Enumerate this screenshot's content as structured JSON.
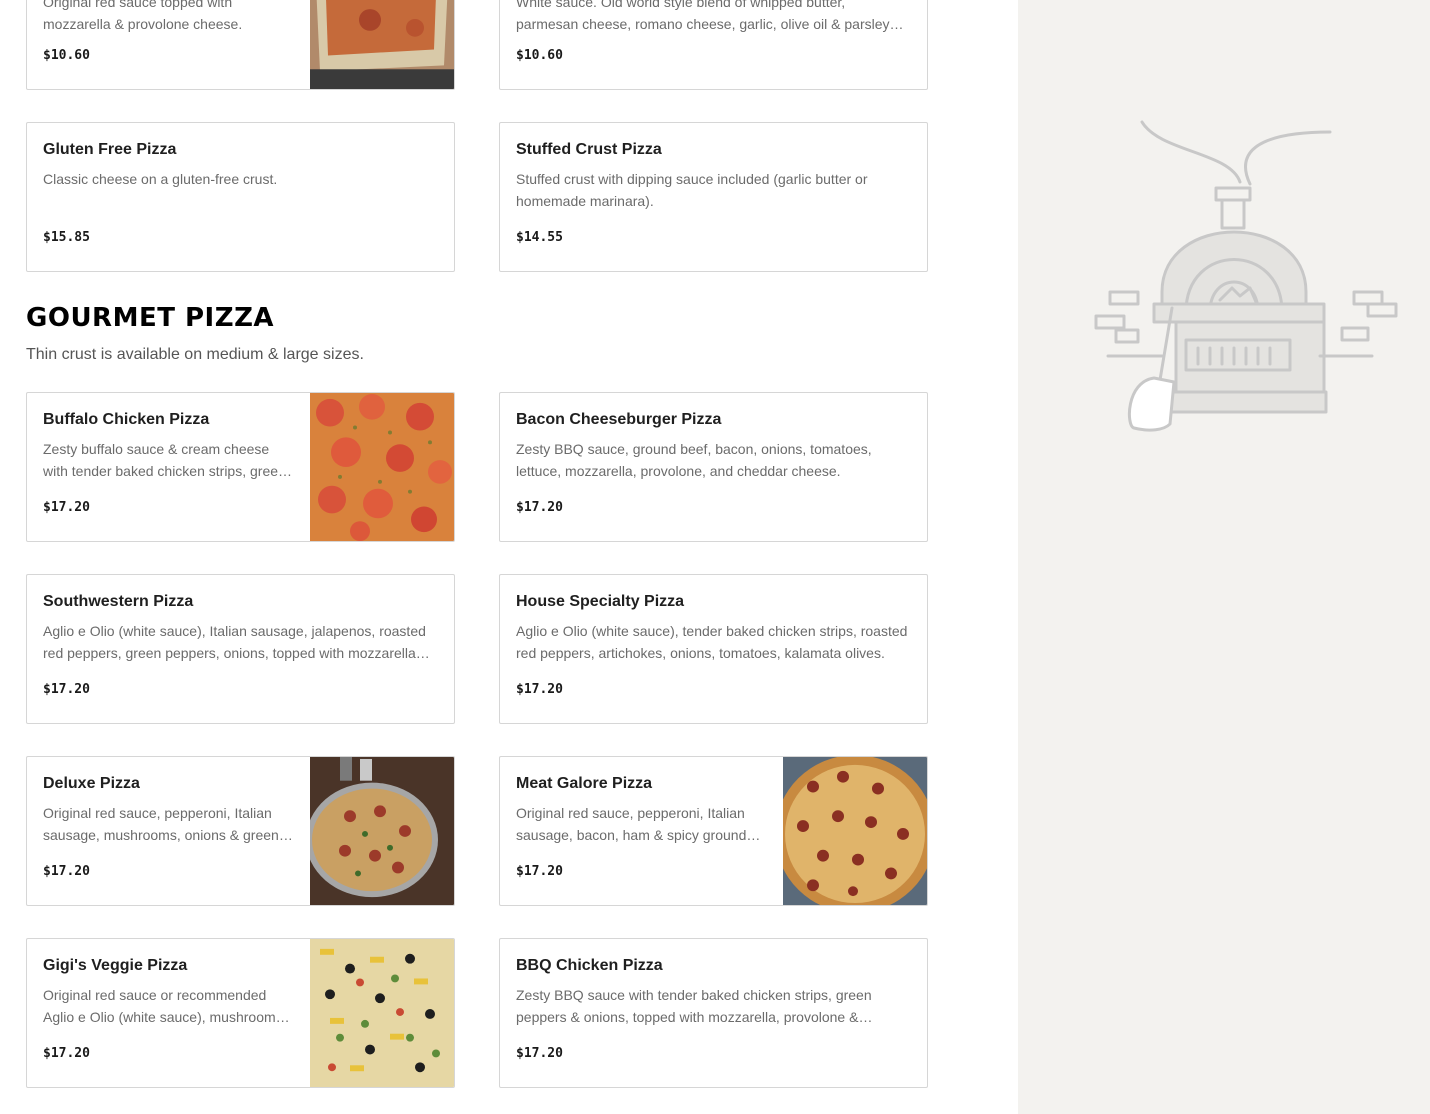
{
  "top_items": [
    {
      "name": "",
      "desc": "Original red sauce topped with mozzarella & provolone cheese.",
      "price": "$10.60"
    },
    {
      "name": "",
      "desc": "White sauce. Old world style blend of whipped butter, parmesan cheese, romano cheese, garlic, olive oil & parsley flakes.",
      "price": "$10.60"
    }
  ],
  "items_a": [
    {
      "name": "Gluten Free Pizza",
      "desc": "Classic cheese on a gluten-free crust.",
      "price": "$15.85"
    },
    {
      "name": "Stuffed Crust Pizza",
      "desc": "Stuffed crust with dipping sauce included (garlic butter or homemade marinara).",
      "price": "$14.55"
    }
  ],
  "gourmet": {
    "title": "GOURMET PIZZA",
    "note": "Thin crust is available on medium & large sizes.",
    "items": [
      {
        "name": "Buffalo Chicken Pizza",
        "desc": "Zesty buffalo sauce & cream cheese with tender baked chicken strips, green peppers & onions.",
        "price": "$17.20"
      },
      {
        "name": "Bacon Cheeseburger Pizza",
        "desc": "Zesty BBQ sauce, ground beef, bacon, onions, tomatoes, lettuce, mozzarella, provolone, and cheddar cheese.",
        "price": "$17.20"
      },
      {
        "name": "Southwestern Pizza",
        "desc": "Aglio e Olio (white sauce), Italian sausage, jalapenos, roasted red peppers, green peppers, onions, topped with mozzarella cheese.",
        "price": "$17.20"
      },
      {
        "name": "House Specialty Pizza",
        "desc": "Aglio e Olio (white sauce), tender baked chicken strips, roasted red peppers, artichokes, onions, tomatoes, kalamata olives.",
        "price": "$17.20"
      },
      {
        "name": "Deluxe Pizza",
        "desc": "Original red sauce, pepperoni, Italian sausage, mushrooms, onions & green peppers.",
        "price": "$17.20"
      },
      {
        "name": "Meat Galore Pizza",
        "desc": "Original red sauce, pepperoni, Italian sausage, bacon, ham & spicy ground beef.",
        "price": "$17.20"
      },
      {
        "name": "Gigi's Veggie Pizza",
        "desc": "Original red sauce or recommended Aglio e Olio (white sauce), mushrooms, onions, green peppers, black olives.",
        "price": "$17.20"
      },
      {
        "name": "BBQ Chicken Pizza",
        "desc": "Zesty BBQ sauce with tender baked chicken strips, green peppers & onions, topped with mozzarella, provolone & cheddar.",
        "price": "$17.20"
      }
    ]
  },
  "colors": {
    "sidebar_bg": "#f3f2ef",
    "border": "#d6d6d6",
    "muted_text": "#6b6b6b"
  }
}
